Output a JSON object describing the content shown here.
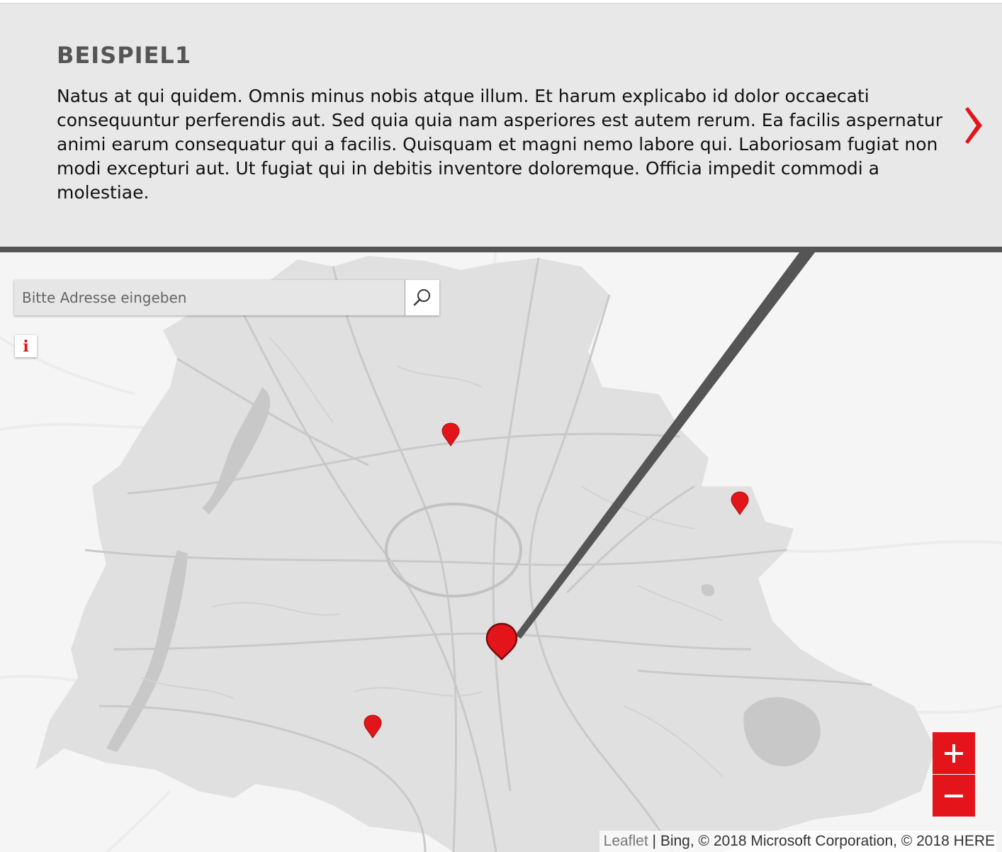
{
  "panel": {
    "title": "BEISPIEL1",
    "text": "Natus at qui quidem. Omnis minus nobis atque illum. Et harum explicabo id dolor occaecati consequuntur perferendis aut. Sed quia quia nam asperiores est autem rerum. Ea facilis aspernatur animi earum consequatur qui a facilis. Quisquam et magni nemo labore qui. Laboriosam fugiat non modi excepturi aut. Ut fugiat qui in debitis inventore doloremque. Officia impedit commodi a molestiae.",
    "next_icon": "chevron-right-icon"
  },
  "map": {
    "search": {
      "placeholder": "Bitte Adresse eingeben",
      "value": "",
      "icon": "search-icon"
    },
    "info_button": {
      "label": "i"
    },
    "zoom": {
      "in_label": "+",
      "out_label": "−"
    },
    "attribution": {
      "leaflet": "Leaflet",
      "separator": " | ",
      "text": "Bing, © 2018 Microsoft Corporation, © 2018 HERE"
    },
    "markers": [
      {
        "name": "marker-north",
        "selected": false
      },
      {
        "name": "marker-east",
        "selected": false
      },
      {
        "name": "marker-center-selected",
        "selected": true
      },
      {
        "name": "marker-southwest",
        "selected": false
      }
    ]
  },
  "colors": {
    "accent": "#e3151a",
    "panel_background": "#e8e8e8",
    "divider": "#555555",
    "title": "#555555"
  }
}
